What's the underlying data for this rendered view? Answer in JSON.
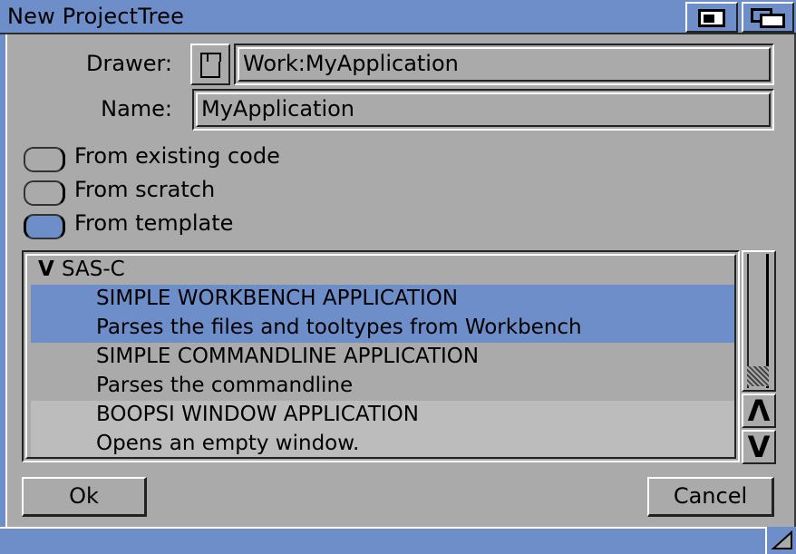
{
  "window": {
    "title": "New ProjectTree"
  },
  "colors": {
    "accent": "#6d8ec9",
    "background": "#aaaaaa"
  },
  "form": {
    "drawer_label": "Drawer:",
    "drawer_value": "Work:MyApplication",
    "name_label": "Name:",
    "name_value": "MyApplication"
  },
  "options": [
    {
      "label": "From existing code",
      "selected": false
    },
    {
      "label": "From scratch",
      "selected": false
    },
    {
      "label": "From template",
      "selected": true
    }
  ],
  "templates": {
    "group_arrow": "V",
    "group_label": "SAS-C",
    "items": [
      {
        "name": "SIMPLE WORKBENCH APPLICATION",
        "description": "Parses the files and tooltypes from Workbench",
        "selected": true
      },
      {
        "name": "SIMPLE COMMANDLINE APPLICATION",
        "description": "Parses the commandline",
        "selected": false
      },
      {
        "name": "BOOPSI WINDOW APPLICATION",
        "description": "Opens an empty window.",
        "selected": false
      }
    ]
  },
  "scrollbar": {
    "up_glyph": "Λ",
    "down_glyph": "V"
  },
  "buttons": {
    "ok_label": "Ok",
    "cancel_label": "Cancel"
  }
}
